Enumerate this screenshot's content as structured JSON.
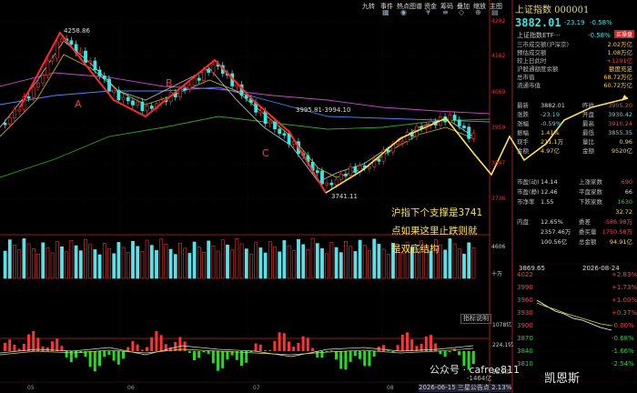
{
  "toolbar": {
    "items": [
      "九转",
      "事件",
      "热点图谱",
      "资金",
      "筹码",
      "叠加",
      "缩放",
      "主图"
    ]
  },
  "chart_labels": {
    "high_price": "4258.86",
    "low_price": "3741.11",
    "line_label": "3995.81-3994.10",
    "wave_a": "A",
    "wave_b": "B",
    "wave_c": "C",
    "y_axis": [
      "4292",
      "4162",
      "4069",
      "3959",
      "3847",
      "3736"
    ],
    "vol_axis": [
      "4606",
      "十万"
    ],
    "macd_axis": [
      "1078亿",
      "224.1亿",
      "55.9亿"
    ],
    "x_axis": [
      "05",
      "06",
      "07",
      "08"
    ],
    "indicator_button": "指标说明",
    "bottom_status": "2026-06-15 三星公告点 2.13%",
    "bottom_status2": "-1464亿"
  },
  "annotation": {
    "line1": "沪指下个支撑是3741",
    "line2": "点如果这里止跌则就",
    "line3": "是双底结构"
  },
  "panel": {
    "title": "上证指数 000001",
    "price": "3882.01",
    "change": "-23.19",
    "change_pct": "-0.58%",
    "badge": "买操盘",
    "etf_label": "上证指数ETF···",
    "etf_pct": "-0.58%",
    "stats": [
      {
        "k": "三市成交额(沪深京)",
        "v": "2.02万亿",
        "c": "#ffd24a"
      },
      {
        "k": "预估成交额",
        "v": "1.08万亿",
        "c": "#ffd24a"
      },
      {
        "k": "较上日此时",
        "v": "+1291亿",
        "c": "#ff4040"
      },
      {
        "k": "沪股通额度余额",
        "v": "额度充足",
        "c": "#ffd24a"
      },
      {
        "k": "总市值",
        "v": "68.72万亿",
        "c": "#ffd24a"
      },
      {
        "k": "流通市值",
        "v": "60.72万亿",
        "c": "#ffd24a"
      }
    ],
    "quote": [
      [
        "最新",
        "3882.01",
        "昨收",
        "3905.20"
      ],
      [
        "涨跌",
        "-23.19",
        "开盘",
        "3930.42"
      ],
      [
        "涨幅",
        "-0.59%",
        "最高",
        "3910.24"
      ],
      [
        "振幅",
        "1.41%",
        "最低",
        "3855.35"
      ],
      [
        "现手",
        "211.1万",
        "量比",
        "0.96"
      ],
      [
        "金额",
        "4.97亿",
        "金额",
        "9520亿"
      ]
    ],
    "breadth": [
      [
        "市盈(动)",
        "14.14",
        "上涨家数",
        "690"
      ],
      [
        "市盈(静)",
        "12.46",
        "平盘家数",
        "66"
      ],
      [
        "市净率",
        "1.55",
        "下跌家数",
        "1630"
      ],
      [
        "",
        "",
        "",
        "32.72"
      ],
      [
        "内盘",
        "12.65%",
        "委差",
        "-586.98万"
      ],
      [
        "",
        "2357.46万",
        "委买量",
        "1750.58万"
      ],
      [
        "",
        "100.56亿",
        "总金额",
        "94.91亿"
      ]
    ],
    "mini_head_price": "3869.65",
    "mini_head_date": "2026-08-24",
    "mini_axis": [
      "4022",
      "3990",
      "3960",
      "3930",
      "3900",
      "3870",
      "3840",
      "3810"
    ],
    "mini_pcts": [
      "+2.83%",
      "+1.73%",
      "+1.00%",
      "+0.37%",
      "-0.00%",
      "-0.68%",
      "-1.66%",
      "-2.54%"
    ]
  },
  "watermark": {
    "left": "公众号 · cafree811",
    "right": "凯恩斯"
  },
  "colors": {
    "up": "#ff3333",
    "down": "#39e6e6",
    "annotation": "#ffe34d",
    "volume": "#5ae0e8",
    "macd_up": "#ff3333",
    "macd_down": "#22dd22"
  }
}
